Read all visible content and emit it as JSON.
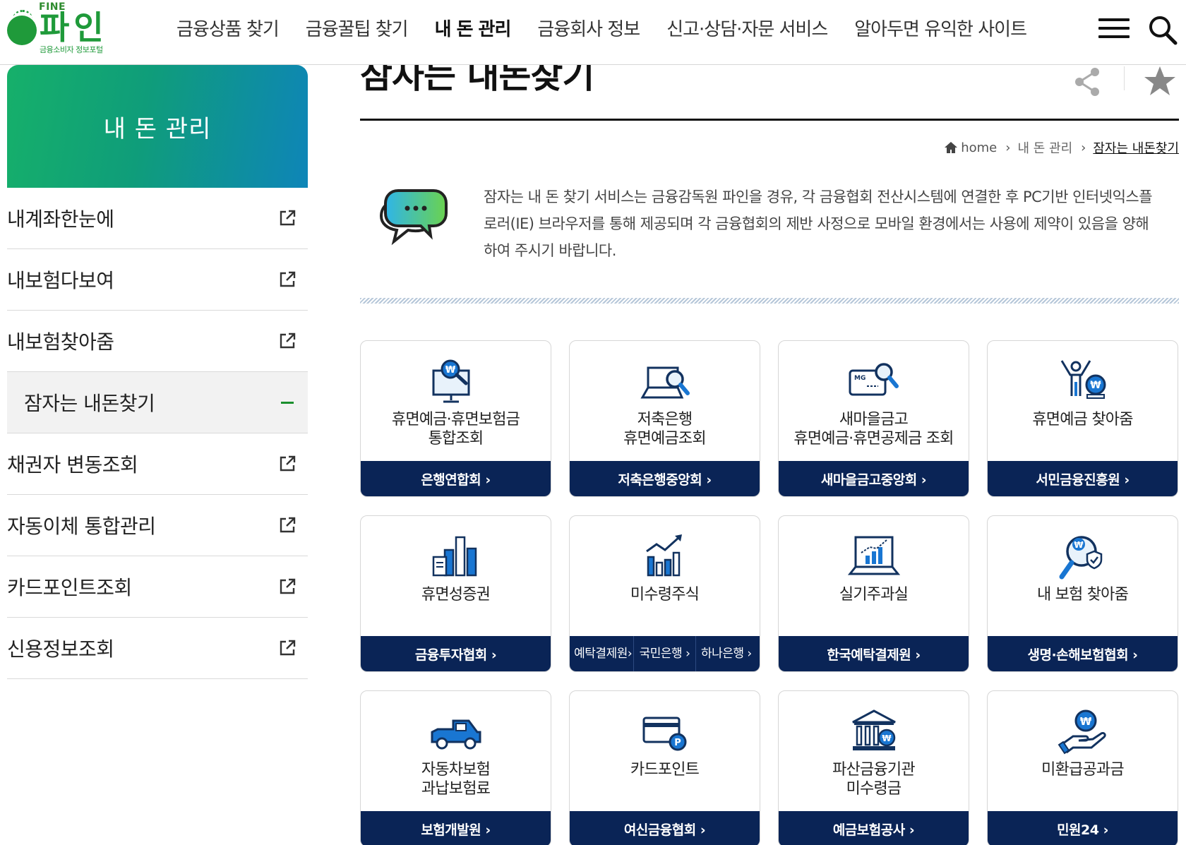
{
  "header": {
    "logo": {
      "fine": "FINE",
      "name": "파인",
      "sub": "금융소비자 정보포털"
    },
    "nav": [
      "금융상품 찾기",
      "금융꿀팁 찾기",
      "내 돈 관리",
      "금융회사 정보",
      "신고·상담·자문 서비스",
      "알아두면 유익한 사이트"
    ],
    "active_nav": "내 돈 관리"
  },
  "sidebar": {
    "title": "내 돈 관리",
    "items": [
      {
        "label": "내계좌한눈에",
        "icon": "external-link-icon"
      },
      {
        "label": "내보험다보여",
        "icon": "external-link-icon"
      },
      {
        "label": "내보험찾아줌",
        "icon": "external-link-icon"
      },
      {
        "label": "잠자는 내돈찾기",
        "icon": "minus-icon",
        "current": true
      },
      {
        "label": "채권자 변동조회",
        "icon": "external-link-icon"
      },
      {
        "label": "자동이체 통합관리",
        "icon": "external-link-icon"
      },
      {
        "label": "카드포인트조회",
        "icon": "external-link-icon"
      },
      {
        "label": "신용정보조회",
        "icon": "external-link-icon"
      }
    ]
  },
  "main": {
    "title": "잠자는 내돈찾기",
    "breadcrumb": {
      "home": "home",
      "level1": "내 돈 관리",
      "current": "잠자는 내돈찾기"
    },
    "notice": "잠자는 내 돈 찾기 서비스는 금융감독원 파인을 경유, 각 금융협회 전산시스템에 연결한 후 PC기반 인터넷익스플로러(IE) 브라우저를 통해 제공되며 각 금융협회의 제반 사정으로 모바일 환경에서는 사용에 제약이 있음을 양해하여 주시기 바랍니다.",
    "cards": [
      {
        "label": "휴면예금·휴면보험금\n통합조회",
        "icon": "monitor-search-icon",
        "links": [
          "은행연합회 ›"
        ]
      },
      {
        "label": "저축은행\n휴면예금조회",
        "icon": "laptop-search-icon",
        "links": [
          "저축은행중앙회 ›"
        ]
      },
      {
        "label": "새마을금고\n휴면예금·휴면공제금 조회",
        "icon": "card-search-icon",
        "links": [
          "새마을금고중앙회 ›"
        ]
      },
      {
        "label": "휴면예금 찾아줌",
        "icon": "person-coin-icon",
        "links": [
          "서민금융진흥원 ›"
        ]
      },
      {
        "label": "휴면성증권",
        "icon": "document-chart-icon",
        "links": [
          "금융투자협회 ›"
        ]
      },
      {
        "label": "미수령주식",
        "icon": "rising-chart-icon",
        "links": [
          "예탁결제원›",
          "국민은행 ›",
          "하나은행 ›"
        ]
      },
      {
        "label": "실기주과실",
        "icon": "laptop-chart-icon",
        "links": [
          "한국예탁결제원 ›"
        ]
      },
      {
        "label": "내 보험 찾아줌",
        "icon": "magnifier-shield-icon",
        "links": [
          "생명·손해보험협회 ›"
        ]
      },
      {
        "label": "자동차보험\n과납보험료",
        "icon": "car-icon",
        "links": [
          "보험개발원 ›"
        ]
      },
      {
        "label": "카드포인트",
        "icon": "card-point-icon",
        "links": [
          "여신금융협회 ›"
        ]
      },
      {
        "label": "파산금융기관\n미수령금",
        "icon": "bank-icon",
        "links": [
          "예금보험공사 ›"
        ]
      },
      {
        "label": "미환급공과금",
        "icon": "hand-coin-icon",
        "links": [
          "민원24 ›"
        ]
      }
    ]
  },
  "colors": {
    "brand_green": "#1f9a3a",
    "navy": "#0a2456",
    "icon_blue": "#1976d2",
    "icon_navy": "#12325f"
  }
}
